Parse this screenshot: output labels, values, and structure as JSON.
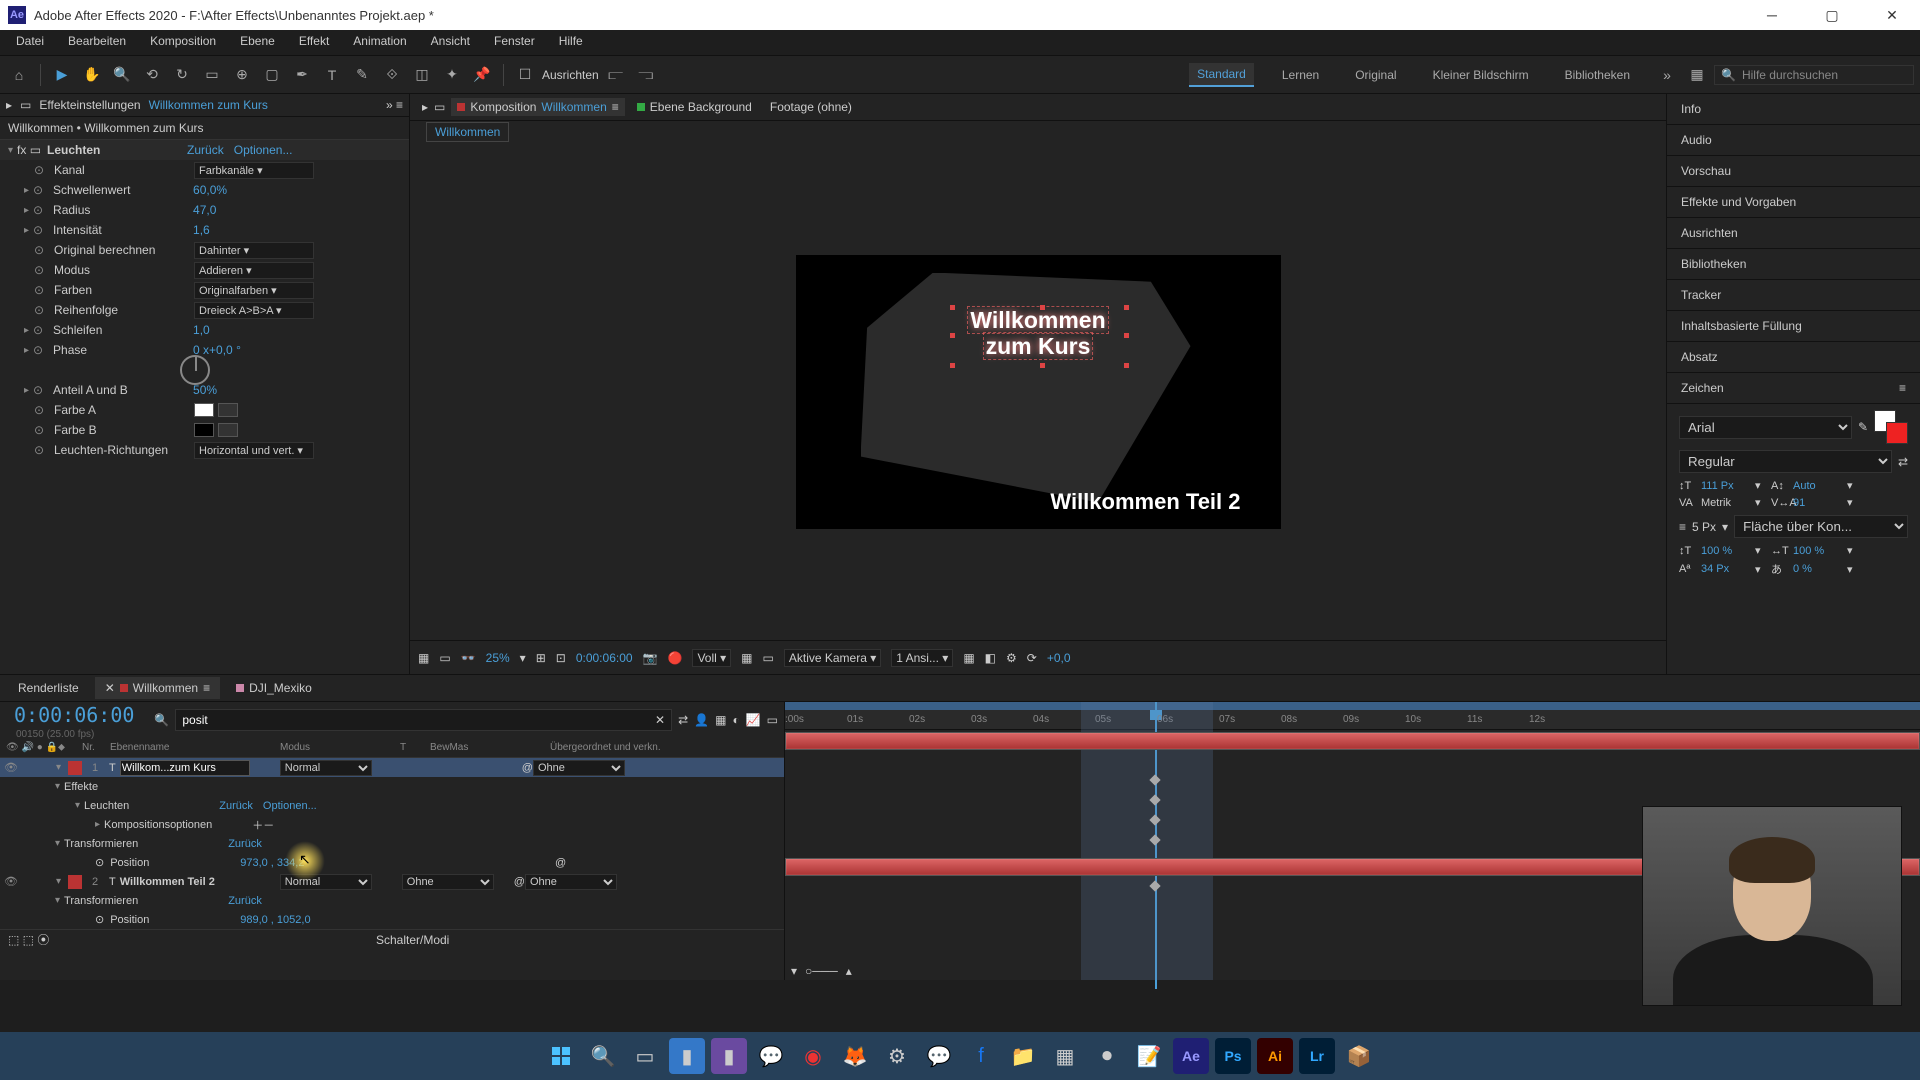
{
  "titlebar": {
    "text": "Adobe After Effects 2020 - F:\\After Effects\\Unbenanntes Projekt.aep *",
    "icon": "Ae"
  },
  "menu": {
    "items": [
      "Datei",
      "Bearbeiten",
      "Komposition",
      "Ebene",
      "Effekt",
      "Animation",
      "Ansicht",
      "Fenster",
      "Hilfe"
    ]
  },
  "toolbar": {
    "align_label": "Ausrichten",
    "workspaces": [
      "Standard",
      "Lernen",
      "Original",
      "Kleiner Bildschirm",
      "Bibliotheken"
    ],
    "active_ws": 0,
    "search_ph": "Hilfe durchsuchen"
  },
  "fx_panel": {
    "tab_label": "Effekteinstellungen",
    "tab_link": "Willkommen zum Kurs",
    "breadcrumb": "Willkommen • Willkommen zum Kurs",
    "effect_name": "Leuchten",
    "reset": "Zurück",
    "options": "Optionen...",
    "params": [
      {
        "label": "Kanal",
        "value": "Farbkanäle",
        "type": "dd"
      },
      {
        "label": "Schwellenwert",
        "value": "60,0%",
        "type": "val",
        "arrow": true
      },
      {
        "label": "Radius",
        "value": "47,0",
        "type": "val",
        "arrow": true
      },
      {
        "label": "Intensität",
        "value": "1,6",
        "type": "val",
        "arrow": true
      },
      {
        "label": "Original berechnen",
        "value": "Dahinter",
        "type": "dd"
      },
      {
        "label": "Modus",
        "value": "Addieren",
        "type": "dd"
      },
      {
        "label": "Farben",
        "value": "Originalfarben",
        "type": "dd"
      },
      {
        "label": "Reihenfolge",
        "value": "Dreieck A>B>A",
        "type": "dd"
      },
      {
        "label": "Schleifen",
        "value": "1,0",
        "type": "val",
        "arrow": true
      },
      {
        "label": "Phase",
        "value": "0 x+0,0 °",
        "type": "val",
        "arrow": true,
        "dial": true
      },
      {
        "label": "Anteil A und B",
        "value": "50%",
        "type": "val",
        "arrow": true
      },
      {
        "label": "Farbe A",
        "value": "",
        "type": "swA"
      },
      {
        "label": "Farbe B",
        "value": "",
        "type": "swB"
      },
      {
        "label": "Leuchten-Richtungen",
        "value": "Horizontal und vert.",
        "type": "dd"
      }
    ]
  },
  "viewer": {
    "tabs": [
      {
        "label": "Komposition",
        "extra": "Willkommen",
        "active": true,
        "color": "#b33"
      },
      {
        "label": "Ebene Background",
        "color": "#3a4"
      },
      {
        "label": "Footage (ohne)"
      }
    ],
    "crumb": "Willkommen",
    "text1_line1": "Willkommen",
    "text1_line2": "zum Kurs",
    "text2": "Willkommen Teil 2",
    "controls": {
      "zoom": "25%",
      "time": "0:00:06:00",
      "res": "Voll",
      "cam": "Aktive Kamera",
      "views": "1 Ansi...",
      "expo": "+0,0"
    }
  },
  "right": {
    "panels": [
      "Info",
      "Audio",
      "Vorschau",
      "Effekte und Vorgaben",
      "Ausrichten",
      "Bibliotheken",
      "Tracker",
      "Inhaltsbasierte Füllung",
      "Absatz"
    ],
    "active": "Zeichen",
    "char": {
      "font": "Arial",
      "style": "Regular",
      "size": "111 Px",
      "lead": "Auto",
      "kern": "Metrik",
      "track": "91",
      "stroke": "5 Px",
      "stroke_pos": "Fläche über Kon...",
      "vscale": "100 %",
      "hscale": "100 %",
      "baseline": "34 Px",
      "tsume": "0 %"
    }
  },
  "timeline": {
    "tabs": [
      {
        "label": "Renderliste"
      },
      {
        "label": "Willkommen",
        "active": true,
        "color": "#b33"
      },
      {
        "label": "DJI_Mexiko",
        "color": "#c8a"
      }
    ],
    "timecode": "0:00:06:00",
    "timecode_sub": "00150 (25.00 fps)",
    "search": "posit",
    "cols": {
      "nr": "Nr.",
      "name": "Ebenenname",
      "mode": "Modus",
      "t": "T",
      "bm": "BewMas",
      "parent": "Übergeordnet und verkn."
    },
    "ruler": [
      ":00s",
      "01s",
      "02s",
      "03s",
      "04s",
      "05s",
      "06s",
      "07s",
      "08s",
      "09s",
      "10s",
      "11s",
      "12s"
    ],
    "layer1": {
      "nr": "1",
      "name": "Willkom...zum Kurs",
      "mode": "Normal",
      "parent": "Ohne",
      "effekte": "Effekte",
      "leuchten": "Leuchten",
      "reset": "Zurück",
      "options": "Optionen...",
      "komp": "Kompositionsoptionen",
      "transform": "Transformieren",
      "treset": "Zurück",
      "pos": "Position",
      "posval": "973,0 , 334,2"
    },
    "layer2": {
      "nr": "2",
      "name": "Willkommen Teil 2",
      "mode": "Normal",
      "bm": "Ohne",
      "parent": "Ohne",
      "transform": "Transformieren",
      "treset": "Zurück",
      "pos": "Position",
      "posval": "989,0 , 1052,0"
    },
    "foot": "Schalter/Modi"
  }
}
